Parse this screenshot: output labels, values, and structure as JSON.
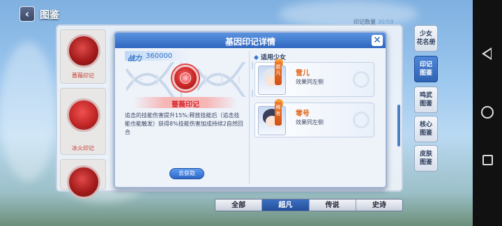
{
  "header": {
    "back_icon": "chevron-left-icon",
    "back_glyph": "‹",
    "title": "图鉴",
    "imprint_count_label": "印记数量",
    "imprint_count_value": "30/59"
  },
  "sidebar": {
    "items": [
      {
        "label_1": "少女",
        "label_2": "花名册",
        "active": false
      },
      {
        "label_1": "印记",
        "label_2": "图鉴",
        "active": true
      },
      {
        "label_1": "鸣武",
        "label_2": "图鉴",
        "active": false
      },
      {
        "label_1": "核心",
        "label_2": "图鉴",
        "active": false
      },
      {
        "label_1": "皮肤",
        "label_2": "图鉴",
        "active": false
      }
    ]
  },
  "bottom_tabs": [
    {
      "label": "全部",
      "active": false
    },
    {
      "label": "超凡",
      "active": true
    },
    {
      "label": "传说",
      "active": false
    },
    {
      "label": "史诗",
      "active": false
    }
  ],
  "background_cards": [
    {
      "label": "蔷薇印记"
    },
    {
      "label": "冰火印记"
    },
    {
      "label": ""
    }
  ],
  "modal": {
    "title": "基因印记详情",
    "close_glyph": "✕",
    "power_label": "战力",
    "power_value": "360000",
    "imprint_name": "蔷薇印记",
    "description": "追击的技能伤害提升15%;释放技能后（追击技能也能触发）获得8%技能伤害加成持续2自然回合",
    "obtain_button": "去获取",
    "applicable_title": "适用少女",
    "girls": [
      {
        "name": "雪儿",
        "badge": "超凡",
        "effect": "效果同左侧",
        "hair_color": "#e4e7ee"
      },
      {
        "name": "零号",
        "badge": "稀有",
        "effect": "效果同左侧",
        "hair_color": "#3b3f5a"
      }
    ],
    "colors": {
      "header": "#2f66c0",
      "accent_red": "#d6272e",
      "name_orange": "#e0681a"
    }
  },
  "icons": {
    "nav_back": "triangle-back-icon",
    "nav_home": "circle-home-icon",
    "nav_recent": "square-recent-icon"
  }
}
